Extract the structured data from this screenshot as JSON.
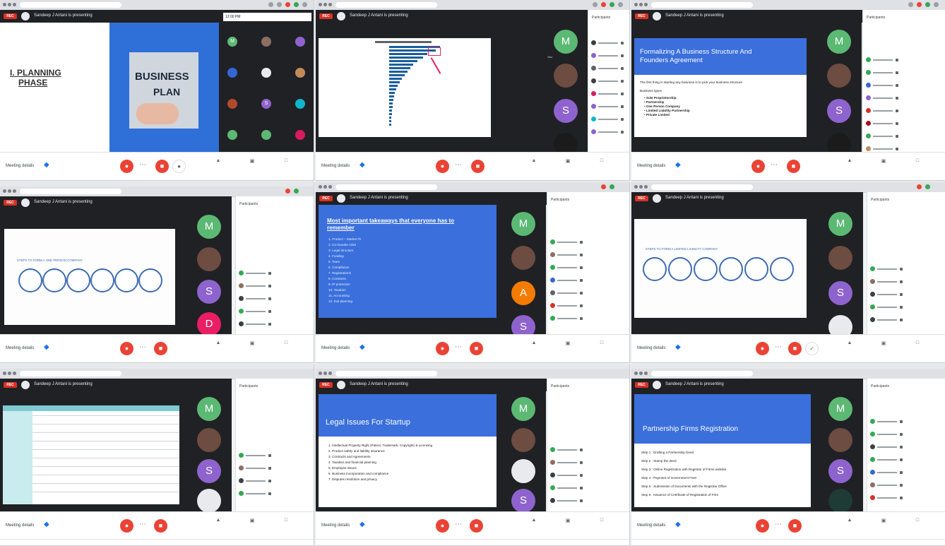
{
  "meeting": {
    "rec_label": "REC",
    "presenter": "Sandeep J Antani is presenting",
    "meeting_details": "Meeting details",
    "panel_title": "Participants"
  },
  "participants_tiles": {
    "m": "M",
    "s": "S",
    "d": "D",
    "a": "A",
    "you": "You"
  },
  "slides": {
    "planning": {
      "line1": "I.",
      "line2": "PLANNING",
      "line3": "PHASE",
      "image_text1": "BUSINESS",
      "image_text2": "PLAN"
    },
    "formalizing": {
      "title": "Formalizing A Business Structure And Founders Agreement",
      "intro": "The first thing in starting any business is to pick your business structure",
      "label": "Business types",
      "items": [
        "Sole Proprietorship",
        "Partnership",
        "One Person Company",
        "Limited Liability Partnership",
        "Private Limited"
      ]
    },
    "opc": {
      "title": "STEPS TO FORM A ONE PERSON COMPANY"
    },
    "mistakes": {
      "title": "Most important takeaways that everyone has to remember",
      "items": [
        "Product – Market Fit",
        "Co-founder roles",
        "Legal structure",
        "Funding",
        "Team",
        "Compliance",
        "Registrations",
        "Contracts",
        "IP protection",
        "Taxation",
        "Accounting",
        "Exit planning"
      ]
    },
    "llp": {
      "title": "STEPS TO FORM A LIMITED LIABILITY COMPANY"
    },
    "legal": {
      "title": "Legal Issues For Startup",
      "items": [
        "Intellectual Property Right (Patent, Trademark, Copyright) & Licensing",
        "Product safety and liability insurance",
        "Contracts and Agreements",
        "Taxation and financial planning",
        "Employee issues",
        "Business Incorporation and compliance",
        "Disputes resolution and privacy"
      ]
    },
    "partnership": {
      "title": "Partnership Firms Registration",
      "steps": [
        "Step 1 : Drafting a Partnership Deed",
        "Step 2 : Stamp the deed",
        "Step 3 : Online Registration with Registrar of Firms website",
        "Step 4 : Payment of Government Fees",
        "Step 5 : Submission of Documents with the Registrar Office",
        "Step 6 : Issuance of Certificate of Registration of Firm"
      ]
    }
  }
}
